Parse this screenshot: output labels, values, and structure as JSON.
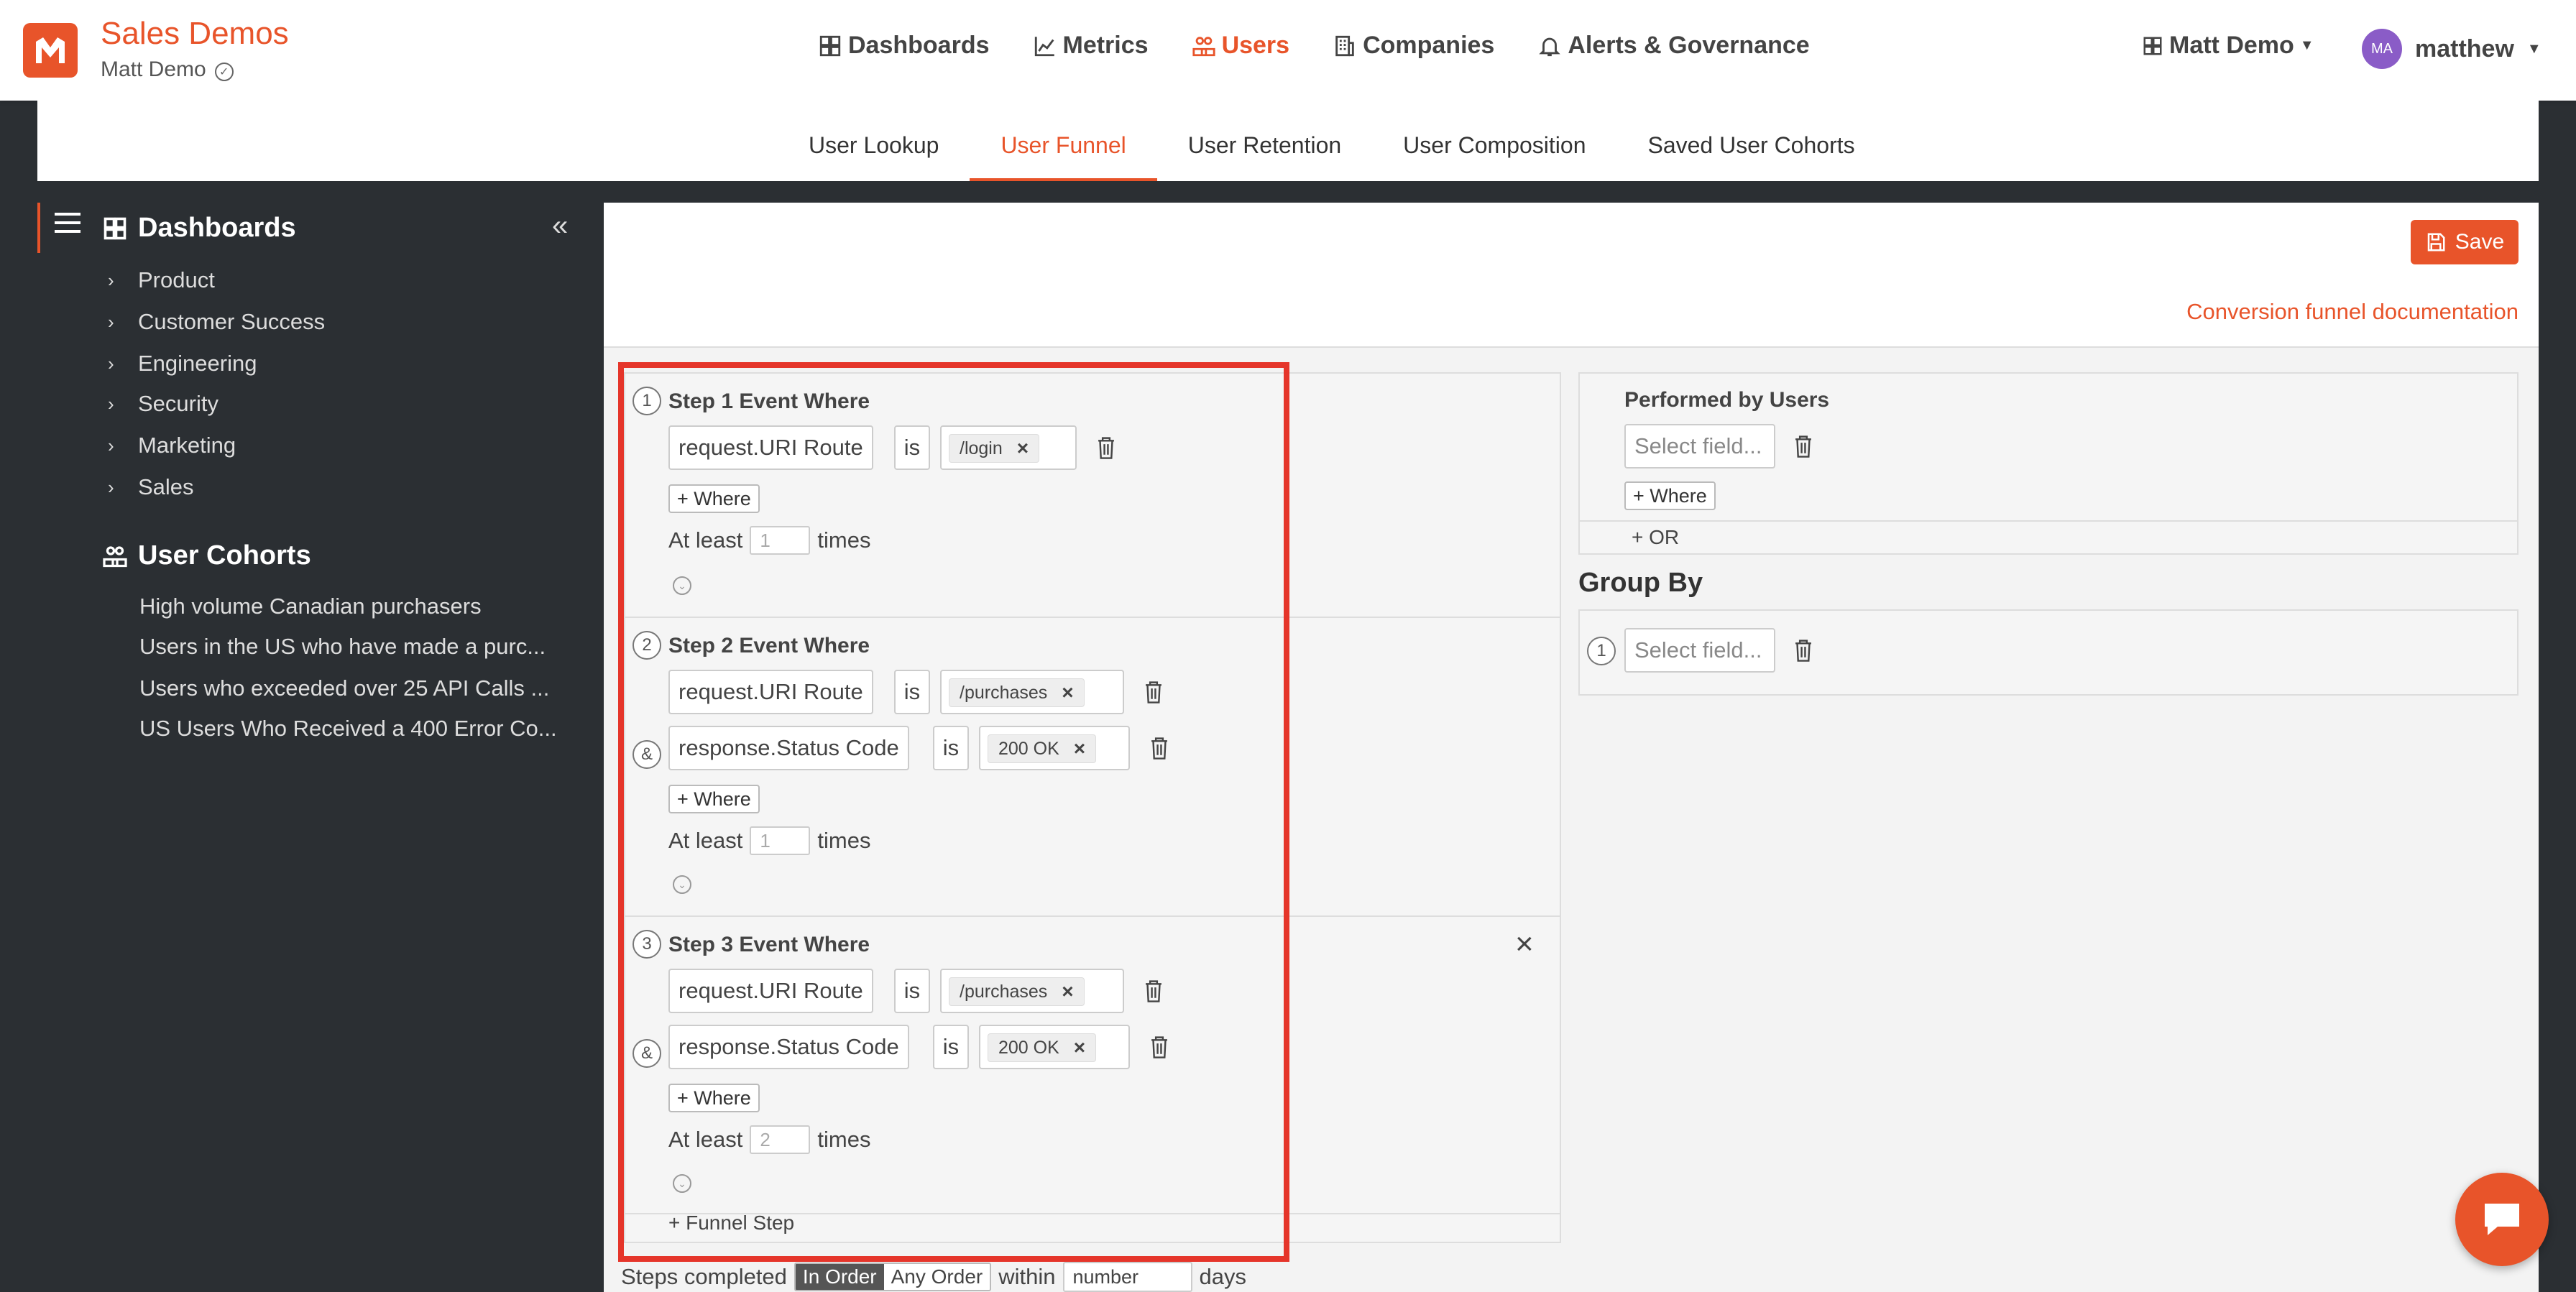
{
  "app": {
    "title": "Sales Demos",
    "subtitle": "Matt Demo"
  },
  "nav": [
    {
      "label": "Dashboards",
      "icon": "dashboard-icon"
    },
    {
      "label": "Metrics",
      "icon": "chart-icon"
    },
    {
      "label": "Users",
      "icon": "users-icon",
      "active": true
    },
    {
      "label": "Companies",
      "icon": "building-icon"
    },
    {
      "label": "Alerts & Governance",
      "icon": "bell-icon"
    }
  ],
  "workspace": "Matt Demo",
  "user": {
    "initials": "MA",
    "name": "matthew"
  },
  "subtabs": [
    "User Lookup",
    "User Funnel",
    "User Retention",
    "User Composition",
    "Saved User Cohorts"
  ],
  "active_subtab": "User Funnel",
  "sidebar": {
    "dashboards_heading": "Dashboards",
    "dashboards": [
      "Product",
      "Customer Success",
      "Engineering",
      "Security",
      "Marketing",
      "Sales"
    ],
    "cohorts_heading": "User Cohorts",
    "cohorts": [
      "High volume Canadian purchasers",
      "Users in the US who have made a purc...",
      "Users who exceeded over 25 API Calls ...",
      "US Users Who Received a 400 Error Co..."
    ]
  },
  "toolbar": {
    "save_label": "Save",
    "doc_link": "Conversion funnel documentation"
  },
  "funnel": {
    "steps": [
      {
        "num": "1",
        "title": "Step 1 Event Where",
        "conditions": [
          {
            "field": "request.URI Route",
            "op": "is",
            "value": "/login"
          }
        ],
        "where": "+ Where",
        "at_least": "At least",
        "times_value": "1",
        "times": "times"
      },
      {
        "num": "2",
        "title": "Step 2 Event Where",
        "conditions": [
          {
            "field": "request.URI Route",
            "op": "is",
            "value": "/purchases"
          },
          {
            "field": "response.Status Code",
            "op": "is",
            "value": "200 OK",
            "connector": "&"
          }
        ],
        "where": "+ Where",
        "at_least": "At least",
        "times_value": "1",
        "times": "times"
      },
      {
        "num": "3",
        "title": "Step 3 Event Where",
        "conditions": [
          {
            "field": "request.URI Route",
            "op": "is",
            "value": "/purchases"
          },
          {
            "field": "response.Status Code",
            "op": "is",
            "value": "200 OK",
            "connector": "&"
          }
        ],
        "where": "+ Where",
        "at_least": "At least",
        "times_value": "2",
        "times": "times"
      }
    ],
    "add_step": "+ Funnel Step"
  },
  "performed": {
    "title": "Performed by Users",
    "placeholder": "Select field...",
    "where": "+ Where",
    "or": "+ OR"
  },
  "group_by": {
    "title": "Group By",
    "num": "1",
    "placeholder": "Select field..."
  },
  "bottom": {
    "steps_completed": "Steps completed",
    "in_order": "In Order",
    "any_order": "Any Order",
    "within": "within",
    "number_placeholder": "number",
    "days": "days"
  },
  "colors": {
    "accent": "#e8542a",
    "highlight": "#e5352a",
    "sidebar_bg": "#2b2f33"
  }
}
